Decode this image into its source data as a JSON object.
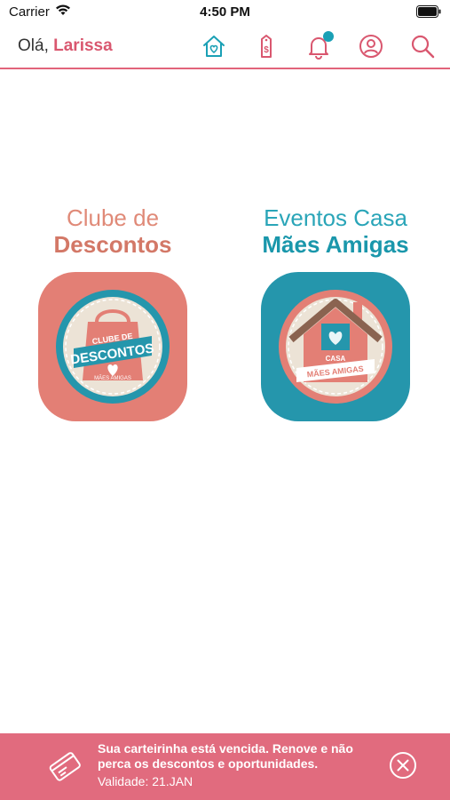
{
  "status_bar": {
    "carrier": "Carrier",
    "time": "4:50 PM"
  },
  "header": {
    "greeting_prefix": "Olá, ",
    "user_name": "Larissa",
    "icons": [
      "home-heart-icon",
      "price-tag-icon",
      "bell-icon",
      "user-icon",
      "search-icon"
    ],
    "notification_badge": true
  },
  "cards": [
    {
      "title_line1": "Clube de",
      "title_line2": "Descontos",
      "logo_text_top": "CLUBE DE",
      "logo_text_main": "DESCONTOS",
      "logo_text_sub": "MÃES AMIGAS"
    },
    {
      "title_line1": "Eventos Casa",
      "title_line2": "Mães Amigas",
      "logo_text_top": "CASA",
      "logo_text_main": "MÃES AMIGAS"
    }
  ],
  "banner": {
    "message": "Sua carteirinha está vencida. Renove e não perca os descontos e oportunidades.",
    "validity": "Validade: 21.JAN"
  },
  "colors": {
    "accent_pink": "#e16b7e",
    "accent_teal": "#1a97ab",
    "salmon": "#e37f75",
    "teal_tile": "#2596ac"
  }
}
